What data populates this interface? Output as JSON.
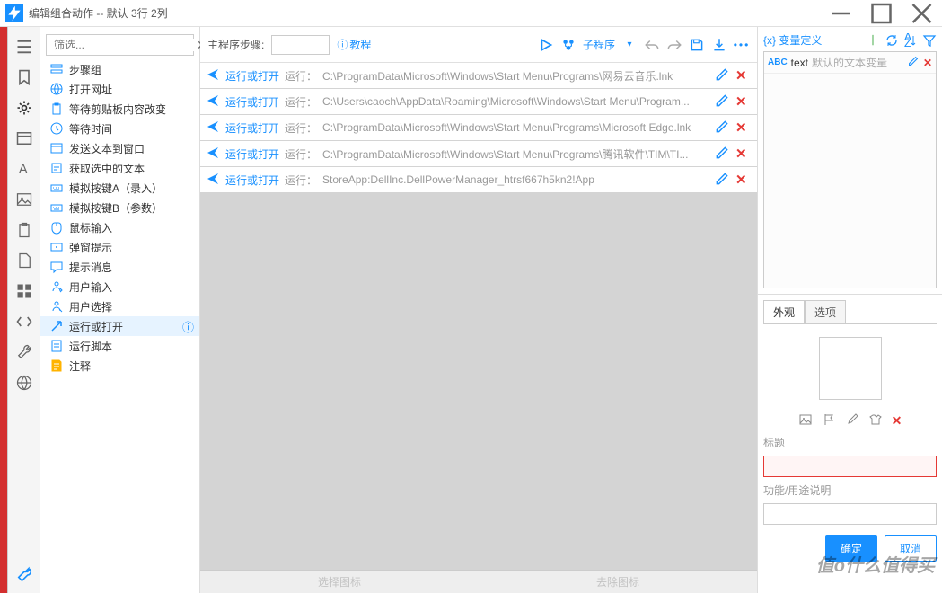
{
  "window": {
    "title": "编辑组合动作 -- 默认 3行 2列"
  },
  "filter": {
    "placeholder": "筛选..."
  },
  "palette": [
    {
      "icon": "group",
      "color": "#1890ff",
      "label": "步骤组"
    },
    {
      "icon": "globe",
      "color": "#1890ff",
      "label": "打开网址"
    },
    {
      "icon": "clipboard",
      "color": "#1890ff",
      "label": "等待剪贴板内容改变"
    },
    {
      "icon": "wait",
      "color": "#1890ff",
      "label": "等待时间"
    },
    {
      "icon": "window",
      "color": "#1890ff",
      "label": "发送文本到窗口"
    },
    {
      "icon": "select-text",
      "color": "#1890ff",
      "label": "获取选中的文本"
    },
    {
      "icon": "keyboard",
      "color": "#1890ff",
      "label": "模拟按键A（录入）"
    },
    {
      "icon": "keyboard",
      "color": "#1890ff",
      "label": "模拟按键B（参数）"
    },
    {
      "icon": "mouse",
      "color": "#1890ff",
      "label": "鼠标输入"
    },
    {
      "icon": "popup",
      "color": "#1890ff",
      "label": "弹窗提示"
    },
    {
      "icon": "message",
      "color": "#1890ff",
      "label": "提示消息"
    },
    {
      "icon": "user-input",
      "color": "#1890ff",
      "label": "用户输入"
    },
    {
      "icon": "user-select",
      "color": "#1890ff",
      "label": "用户选择"
    },
    {
      "icon": "run",
      "color": "#1890ff",
      "label": "运行或打开",
      "selected": true,
      "info": true
    },
    {
      "icon": "script",
      "color": "#1890ff",
      "label": "运行脚本"
    },
    {
      "icon": "note",
      "color": "#ffb300",
      "label": "注释"
    }
  ],
  "toolbar": {
    "steps_label": "主程序步骤:",
    "tutorial": "教程",
    "sub_label": "子程序"
  },
  "steps": [
    {
      "name": "运行或打开",
      "action_label": "运行：",
      "path": "C:\\ProgramData\\Microsoft\\Windows\\Start Menu\\Programs\\网易云音乐.lnk"
    },
    {
      "name": "运行或打开",
      "action_label": "运行：",
      "path": "C:\\Users\\caoch\\AppData\\Roaming\\Microsoft\\Windows\\Start Menu\\Program..."
    },
    {
      "name": "运行或打开",
      "action_label": "运行：",
      "path": "C:\\ProgramData\\Microsoft\\Windows\\Start Menu\\Programs\\Microsoft Edge.lnk"
    },
    {
      "name": "运行或打开",
      "action_label": "运行：",
      "path": "C:\\ProgramData\\Microsoft\\Windows\\Start Menu\\Programs\\腾讯软件\\TIM\\TI..."
    },
    {
      "name": "运行或打开",
      "action_label": "运行：",
      "path": "StoreApp:DellInc.DellPowerManager_htrsf667h5kn2!App"
    }
  ],
  "bottom_bar": {
    "a": "选择图标",
    "b": "去除图标"
  },
  "vars": {
    "header": "{x} 变量定义",
    "items": [
      {
        "name": "text",
        "desc": "默认的文本变量"
      }
    ]
  },
  "appearance": {
    "tab1": "外观",
    "tab2": "选项",
    "title_label": "标题",
    "desc_label": "功能/用途说明",
    "ok": "确定",
    "cancel": "取消"
  },
  "watermark": "值o什么值得买"
}
